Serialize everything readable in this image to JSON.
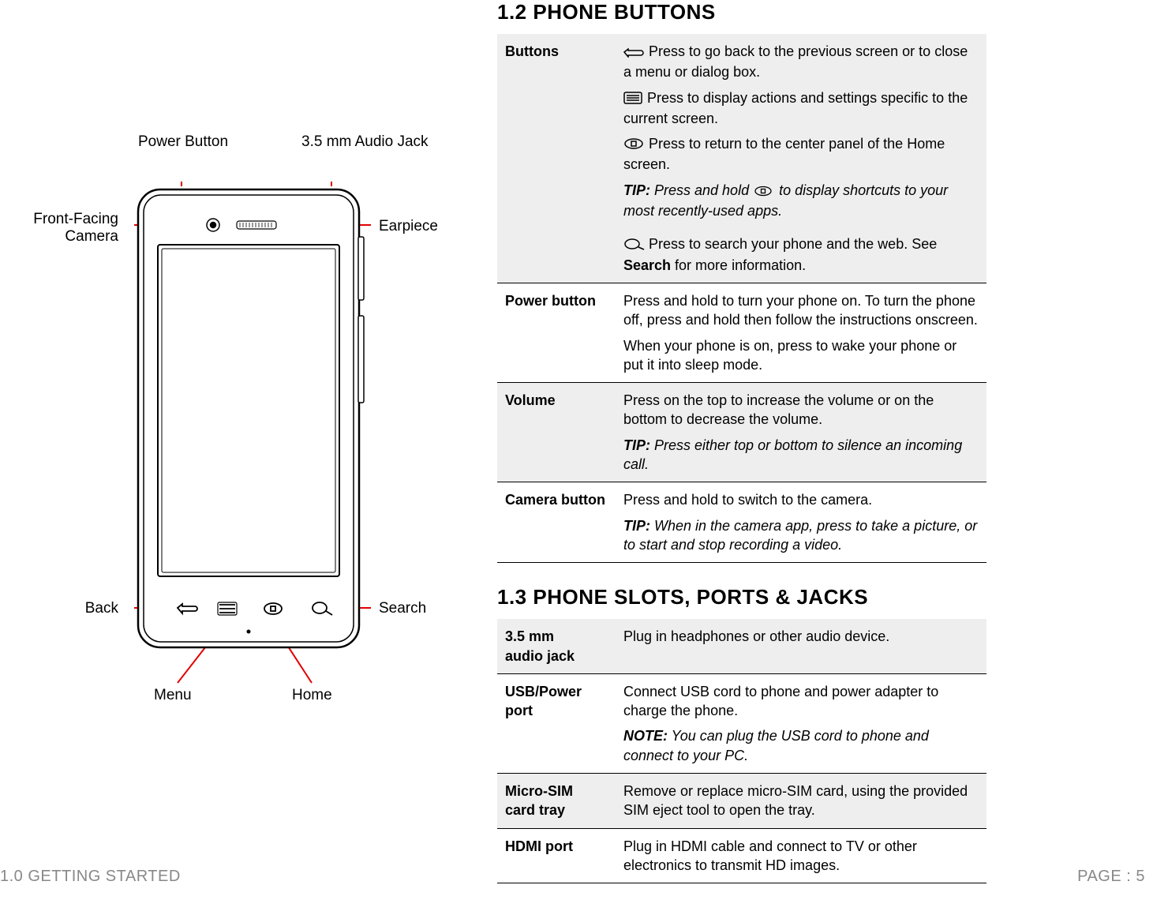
{
  "diagram_labels": {
    "power_button": "Power Button",
    "audio_jack": "3.5 mm Audio Jack",
    "front_camera_l1": "Front-Facing",
    "front_camera_l2": "Camera",
    "earpiece": "Earpiece",
    "back": "Back",
    "search": "Search",
    "menu": "Menu",
    "home": "Home"
  },
  "section_1_2": {
    "heading": "1.2 PHONE BUTTONS",
    "rows": {
      "buttons_key": "Buttons",
      "buttons_back": "Press to go back to the previous screen or to close a menu or dialog box.",
      "buttons_menu": "Press to display actions and settings specific to the current screen.",
      "buttons_home": "Press to return to the center panel of the Home screen.",
      "buttons_home_tip_label": "TIP:",
      "buttons_home_tip": " Press and hold ",
      "buttons_home_tip_tail": " to display shortcuts to your most recently-used apps.",
      "buttons_search_pre": "Press to search your phone and the web. See ",
      "buttons_search_bold": "Search",
      "buttons_search_post": " for more information.",
      "power_key": "Power button",
      "power_p1": "Press and hold to turn your phone on. To turn the phone off, press and hold then follow the instructions onscreen.",
      "power_p2": "When your phone is on, press to wake your phone or put it into sleep mode.",
      "volume_key": "Volume",
      "volume_p1": "Press on the top to increase the volume or on the bottom to decrease the volume.",
      "volume_tip_label": "TIP:",
      "volume_tip": " Press either top or bottom to silence an incoming call.",
      "camera_key": "Camera button",
      "camera_p1": "Press and hold to switch to the camera.",
      "camera_tip_label": "TIP:",
      "camera_tip": " When in the camera app, press to take a picture, or to start and stop recording a video."
    }
  },
  "section_1_3": {
    "heading": "1.3 PHONE SLOTS, PORTS & JACKS",
    "rows": {
      "audio_key_l1": "3.5 mm",
      "audio_key_l2": "audio jack",
      "audio_val": "Plug in headphones or other audio device.",
      "usb_key": "USB/Power port",
      "usb_p1": "Connect USB cord to phone and power adapter to charge the phone.",
      "usb_note_label": "NOTE:",
      "usb_note": " You can plug the USB cord to phone and connect to your PC.",
      "sim_key_l1": "Micro-SIM",
      "sim_key_l2": "card tray",
      "sim_val": "Remove or replace micro-SIM card, using the provided SIM eject tool to open the tray.",
      "hdmi_key": "HDMI port",
      "hdmi_val": "Plug in HDMI cable and connect to TV or other electronics to transmit HD images."
    }
  },
  "footer": {
    "left": "1.0 GETTING STARTED",
    "right": "PAGE : 5"
  }
}
